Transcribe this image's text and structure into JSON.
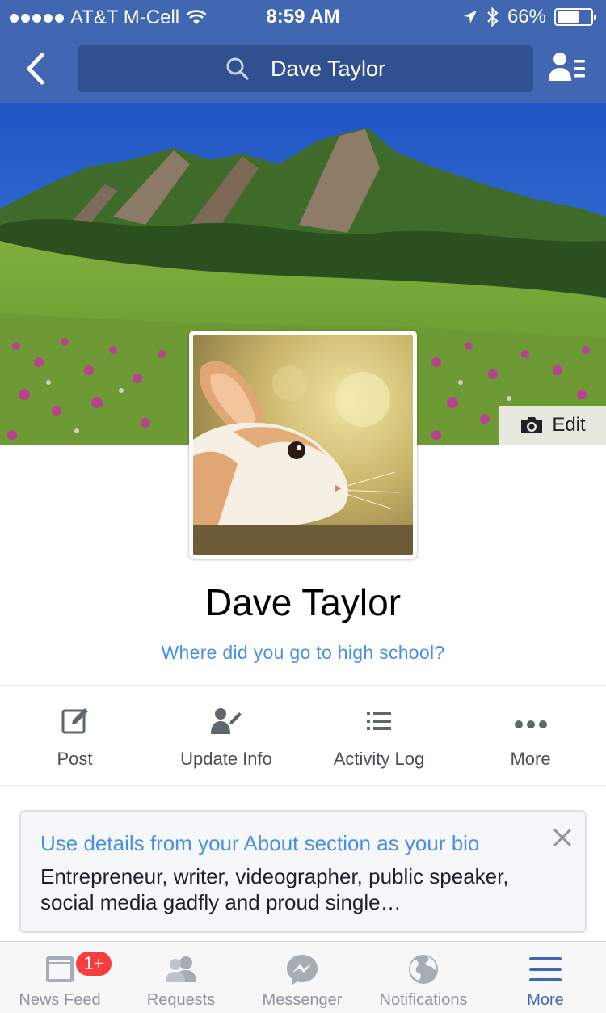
{
  "status_bar": {
    "carrier": "AT&T M-Cell",
    "time": "8:59 AM",
    "battery_percent": "66%",
    "battery_level": 0.66
  },
  "nav": {
    "search_value": "Dave Taylor",
    "back_icon": "chevron-left-icon",
    "profile_switch_icon": "person-list-icon"
  },
  "cover": {
    "edit_label": "Edit"
  },
  "profile": {
    "name": "Dave Taylor",
    "high_school_prompt": "Where did you go to high school?"
  },
  "actions": [
    {
      "label": "Post",
      "icon": "compose-icon"
    },
    {
      "label": "Update Info",
      "icon": "edit-person-icon"
    },
    {
      "label": "Activity Log",
      "icon": "list-icon"
    },
    {
      "label": "More",
      "icon": "more-dots-icon"
    }
  ],
  "bio_card": {
    "title": "Use details from your About section as your bio",
    "text": "Entrepreneur, writer, videographer, public speaker, social media gadfly and proud single…"
  },
  "tabs": [
    {
      "label": "News Feed",
      "icon": "news-feed-icon",
      "badge": "1+"
    },
    {
      "label": "Requests",
      "icon": "friends-icon"
    },
    {
      "label": "Messenger",
      "icon": "messenger-icon"
    },
    {
      "label": "Notifications",
      "icon": "globe-icon"
    },
    {
      "label": "More",
      "icon": "menu-icon",
      "active": true
    }
  ],
  "colors": {
    "brand": "#4267b2",
    "link": "#4a90e2",
    "badge": "#fa3e3e"
  }
}
